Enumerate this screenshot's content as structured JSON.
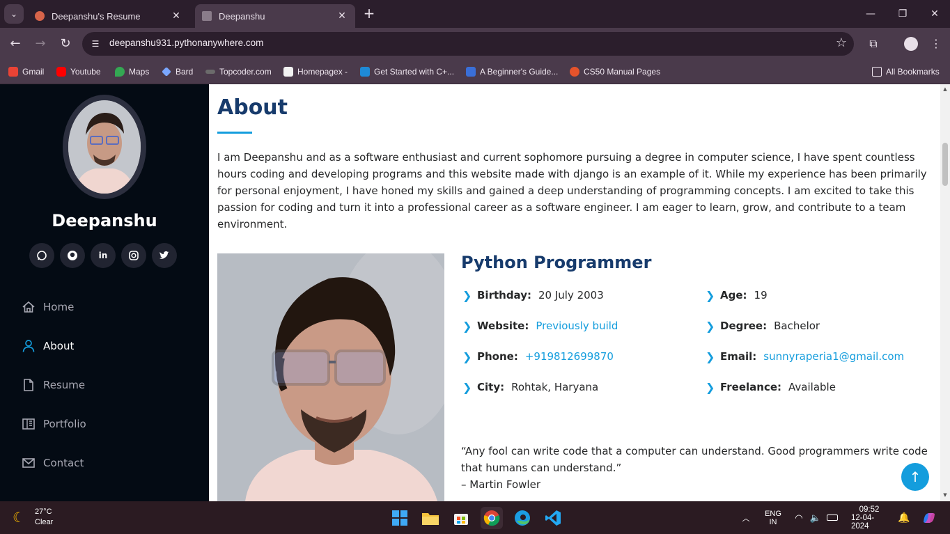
{
  "browser": {
    "tabs": [
      {
        "label": "Deepanshu's Resume",
        "active": false
      },
      {
        "label": "Deepanshu",
        "active": true
      }
    ],
    "url": "deepanshu931.pythonanywhere.com",
    "bookmarks": [
      {
        "label": "Gmail",
        "icon": "gmail-icon"
      },
      {
        "label": "Youtube",
        "icon": "youtube-icon"
      },
      {
        "label": "Maps",
        "icon": "maps-icon"
      },
      {
        "label": "Bard",
        "icon": "bard-icon"
      },
      {
        "label": "Topcoder.com",
        "icon": "topcoder-icon"
      },
      {
        "label": "Homepagex -",
        "icon": "homepagex-icon"
      },
      {
        "label": "Get Started with C+...",
        "icon": "vscode-icon"
      },
      {
        "label": "A Beginner's Guide...",
        "icon": "guide-icon"
      },
      {
        "label": "CS50 Manual Pages",
        "icon": "cs50-icon"
      }
    ],
    "all_bookmarks": "All Bookmarks"
  },
  "sidebar": {
    "name": "Deepanshu",
    "socials": [
      "whatsapp",
      "github",
      "linkedin",
      "instagram",
      "twitter"
    ],
    "nav": [
      {
        "label": "Home",
        "icon": "home-icon",
        "active": false
      },
      {
        "label": "About",
        "icon": "person-icon",
        "active": true
      },
      {
        "label": "Resume",
        "icon": "file-icon",
        "active": false
      },
      {
        "label": "Portfolio",
        "icon": "book-icon",
        "active": false
      },
      {
        "label": "Contact",
        "icon": "envelope-icon",
        "active": false
      }
    ]
  },
  "about": {
    "heading": "About",
    "intro": "I am Deepanshu and as a software enthusiast and current sophomore pursuing a degree in computer science, I have spent countless hours coding and developing programs and this website made with django is an example of it. While my experience has been primarily for personal enjoyment, I have honed my skills and gained a deep understanding of programming concepts. I am excited to take this passion for coding and turn it into a professional career as a software engineer. I am eager to learn, grow, and contribute to a team environment.",
    "role": "Python Programmer",
    "details_left": [
      {
        "label": "Birthday:",
        "value": "20 July 2003"
      },
      {
        "label": "Website:",
        "value": "Previously build"
      },
      {
        "label": "Phone:",
        "value": "+919812699870"
      },
      {
        "label": "City:",
        "value": "Rohtak, Haryana"
      }
    ],
    "details_right": [
      {
        "label": "Age:",
        "value": "19"
      },
      {
        "label": "Degree:",
        "value": "Bachelor"
      },
      {
        "label": "Email:",
        "value": "sunnyraperia1@gmail.com"
      },
      {
        "label": "Freelance:",
        "value": "Available"
      }
    ],
    "quote_line1": "“Any fool can write code that a computer can understand. Good programmers write code",
    "quote_line2": "that humans can understand.”",
    "quote_author": "– Martin Fowler"
  },
  "taskbar": {
    "temp": "27°C",
    "condition": "Clear",
    "lang1": "ENG",
    "lang2": "IN",
    "time": "09:52",
    "date": "12-04-2024"
  },
  "colors": {
    "accent": "#149ddd",
    "heading": "#173b6c",
    "sidebar_bg": "#040b14",
    "chrome_bg": "#4a3a4b"
  }
}
